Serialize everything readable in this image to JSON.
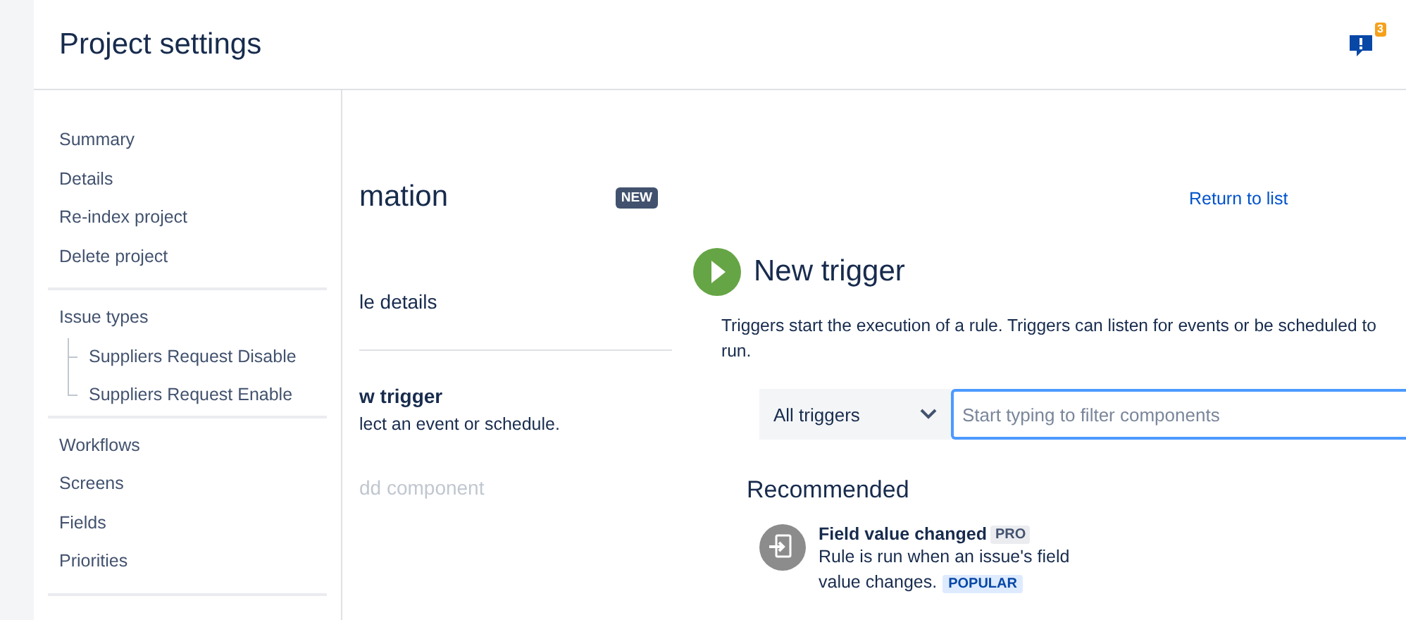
{
  "header": {
    "title": "Project settings",
    "notification_count": "3"
  },
  "sidebar": {
    "groups": [
      {
        "items": [
          {
            "label": "Summary"
          },
          {
            "label": "Details"
          },
          {
            "label": "Re-index project"
          },
          {
            "label": "Delete project"
          }
        ]
      },
      {
        "items": [
          {
            "label": "Issue types",
            "children": [
              {
                "label": "Suppliers Request Disable"
              },
              {
                "label": "Suppliers Request Enable"
              }
            ]
          }
        ]
      },
      {
        "items": [
          {
            "label": "Workflows"
          },
          {
            "label": "Screens"
          },
          {
            "label": "Fields"
          },
          {
            "label": "Priorities"
          }
        ]
      }
    ]
  },
  "rule_panel": {
    "title": "mation",
    "badge": "NEW",
    "steps": [
      {
        "kind": "section",
        "title": "le details"
      },
      {
        "kind": "trigger",
        "title": "w trigger",
        "description": "lect an event or schedule."
      },
      {
        "kind": "placeholder",
        "title": "dd component"
      }
    ]
  },
  "trigger_panel": {
    "return_link": "Return to list",
    "title": "New trigger",
    "description_lines": [
      "Triggers start the execution of a rule. Triggers can listen for events or be scheduled to",
      "run."
    ],
    "filter": {
      "selected": "All triggers",
      "placeholder": "Start typing to filter components"
    },
    "section_title": "Recommended",
    "components": [
      {
        "title": "Field value changed",
        "tag": "PRO",
        "description_lines": [
          "Rule is run when an issue's field",
          "value changes."
        ],
        "badge": "POPULAR"
      }
    ]
  }
}
